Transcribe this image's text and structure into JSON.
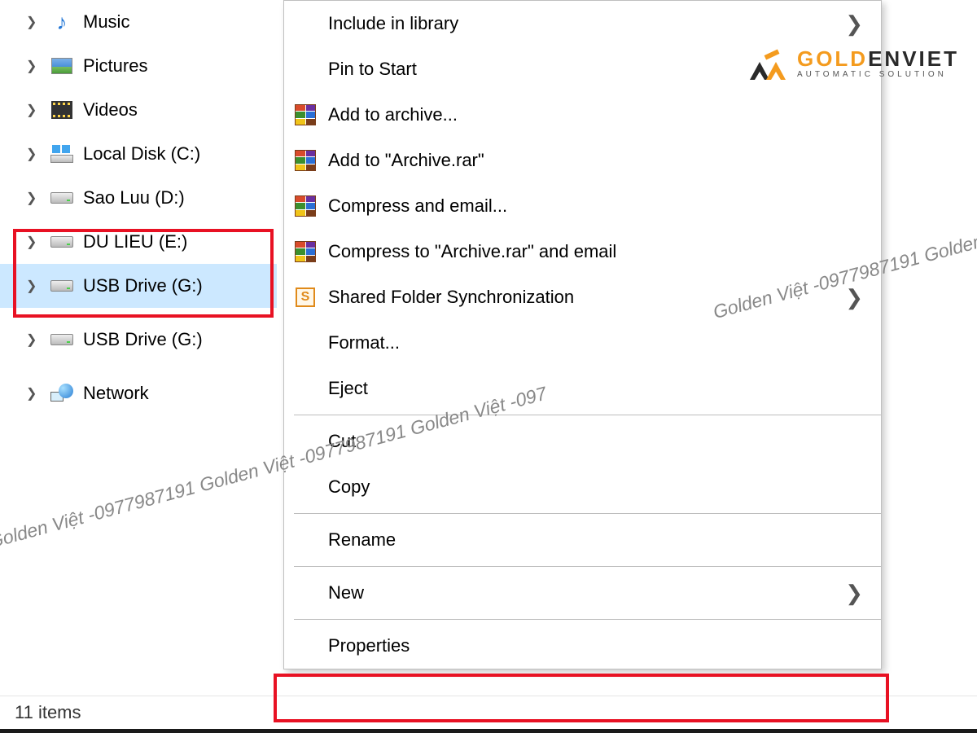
{
  "tree": {
    "items": [
      {
        "label": "Music",
        "icon": "music"
      },
      {
        "label": "Pictures",
        "icon": "pictures"
      },
      {
        "label": "Videos",
        "icon": "videos"
      },
      {
        "label": "Local Disk (C:)",
        "icon": "localc"
      },
      {
        "label": "Sao Luu (D:)",
        "icon": "drive"
      },
      {
        "label": "DU LIEU (E:)",
        "icon": "drive"
      },
      {
        "label": "USB Drive (G:)",
        "icon": "drive",
        "selected": true
      },
      {
        "label": "USB Drive (G:)",
        "icon": "drive"
      },
      {
        "label": "Network",
        "icon": "network"
      }
    ]
  },
  "menu": {
    "include_in_library": "Include in library",
    "pin_to_start": "Pin to Start",
    "add_to_archive": "Add to archive...",
    "add_to_archive_rar": "Add to \"Archive.rar\"",
    "compress_and_email": "Compress and email...",
    "compress_to_archive_rar_email": "Compress to \"Archive.rar\" and email",
    "shared_folder_sync": "Shared Folder Synchronization",
    "format": "Format...",
    "eject": "Eject",
    "cut": "Cut",
    "copy": "Copy",
    "rename": "Rename",
    "new": "New",
    "properties": "Properties"
  },
  "statusbar": {
    "items_count": "11 items"
  },
  "watermark": {
    "text": "Golden Việt -0977987191 Golden Việt -0977987191 Golden Việt -097"
  },
  "logo": {
    "main_gold": "GOLD",
    "main_rest": "ENVIET",
    "sub": "AUTOMATIC SOLUTION"
  }
}
